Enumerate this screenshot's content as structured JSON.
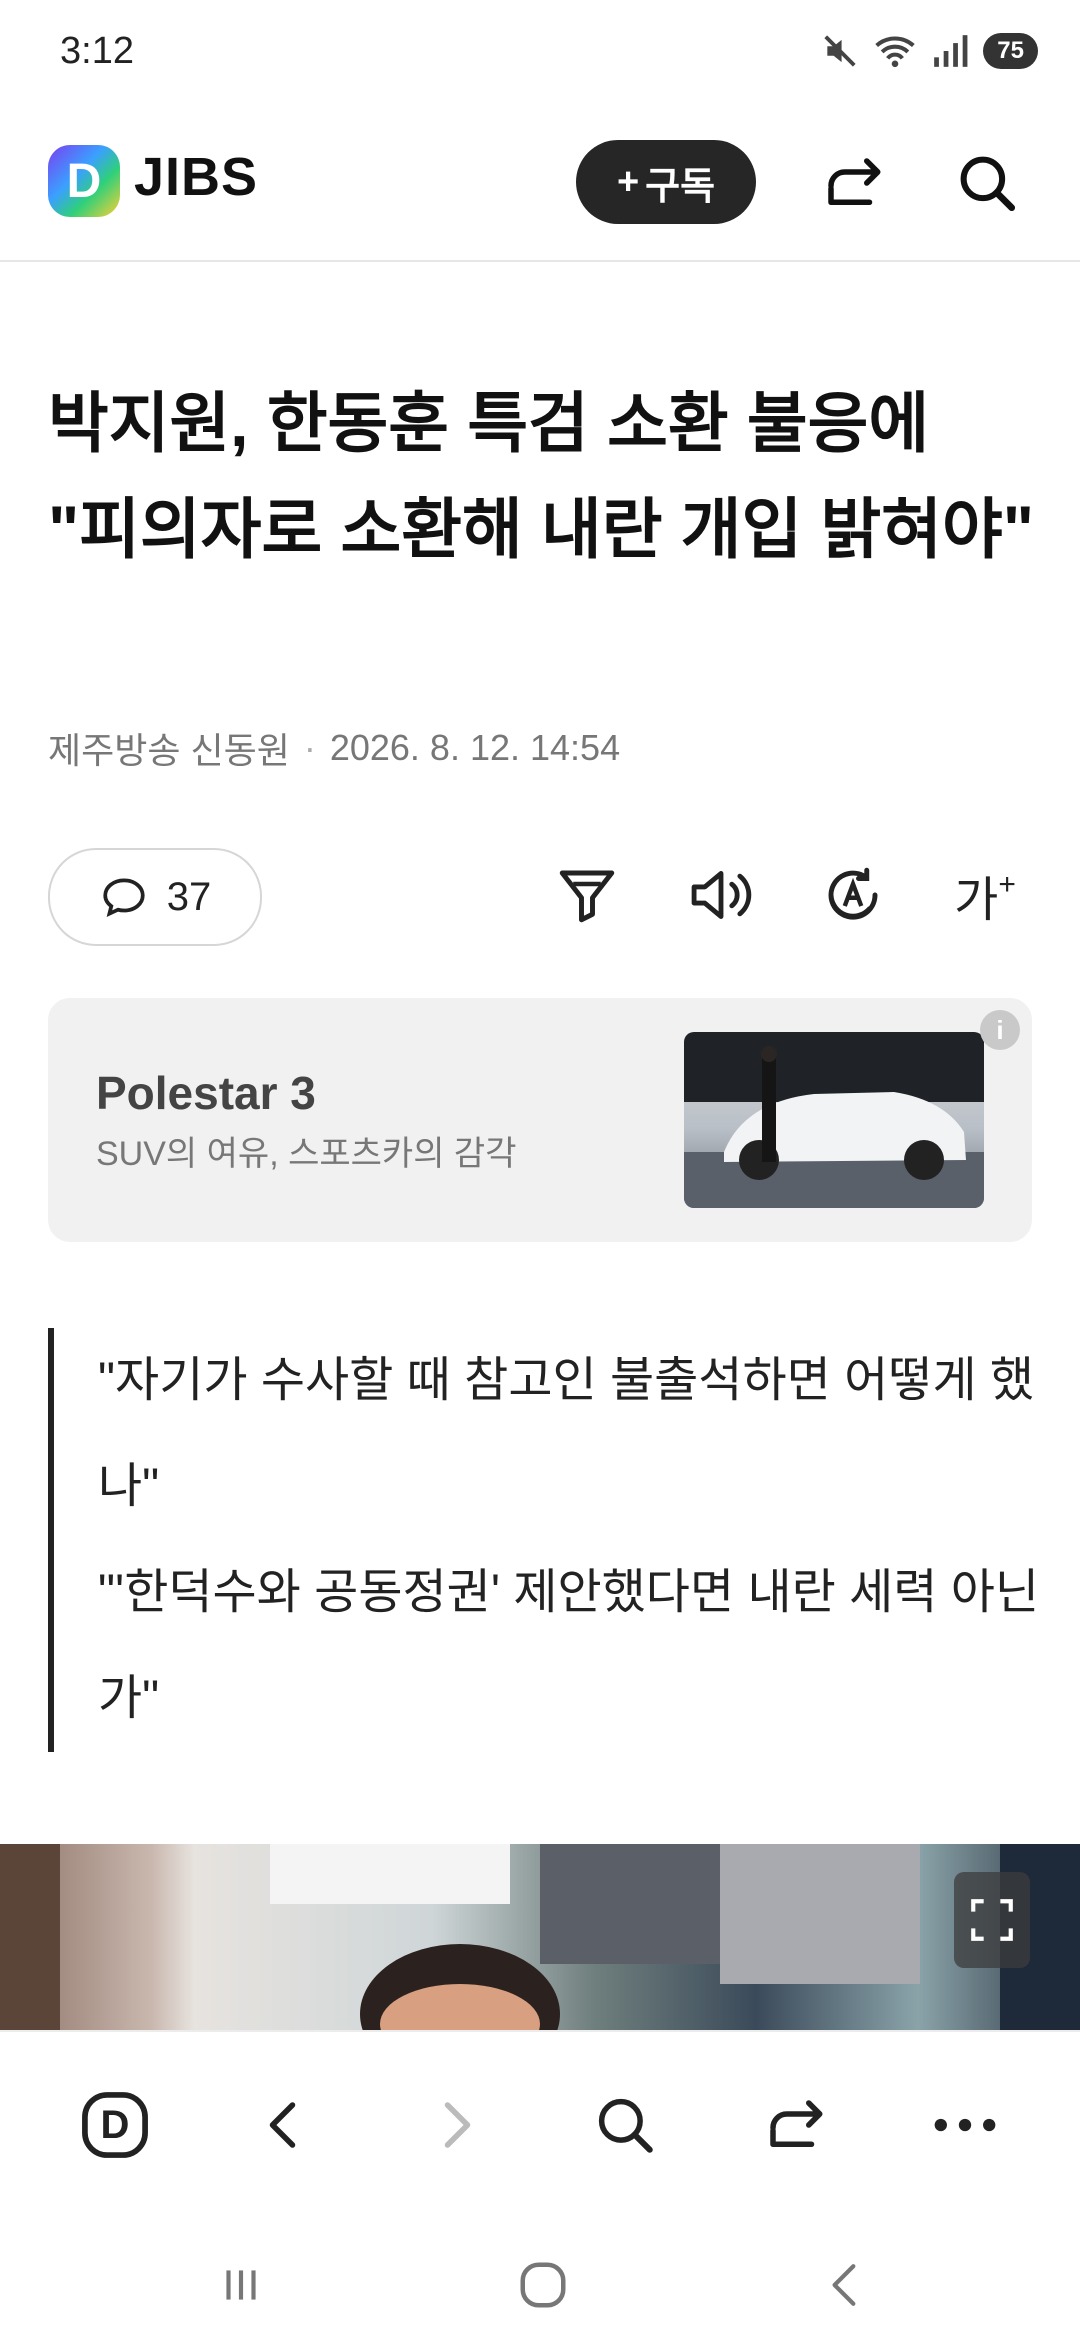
{
  "status_bar": {
    "time": "3:12",
    "battery": "75"
  },
  "header": {
    "logo_letter": "D",
    "brand": "JIBS",
    "subscribe_label": "구독",
    "subscribe_prefix": "+"
  },
  "article": {
    "title": "박지원, 한동훈 특검 소환 불응에 \"피의자로 소환해 내란 개입 밝혀야\"",
    "byline": "제주방송 신동원",
    "date": "2026. 8. 12. 14:54",
    "comment_count": "37",
    "font_size_label": "가",
    "quote_lines": [
      "\"자기가 수사할 때 참고인 불출석하면 어떻게 했나\"",
      "\"'한덕수와 공동정권' 제안했다면 내란 세력 아닌가\""
    ]
  },
  "ad": {
    "title": "Polestar 3",
    "subtitle": "SUV의 여유, 스포츠카의 감각",
    "info_icon": "i"
  },
  "bottom_nav": {
    "logo_letter": "D"
  },
  "icons": [
    "mute-icon",
    "wifi-icon",
    "signal-icon",
    "share-icon",
    "search-icon",
    "comment-icon",
    "filter-icon",
    "speaker-icon",
    "auto-translate-icon",
    "fullscreen-icon",
    "back-icon",
    "forward-icon",
    "more-icon"
  ]
}
